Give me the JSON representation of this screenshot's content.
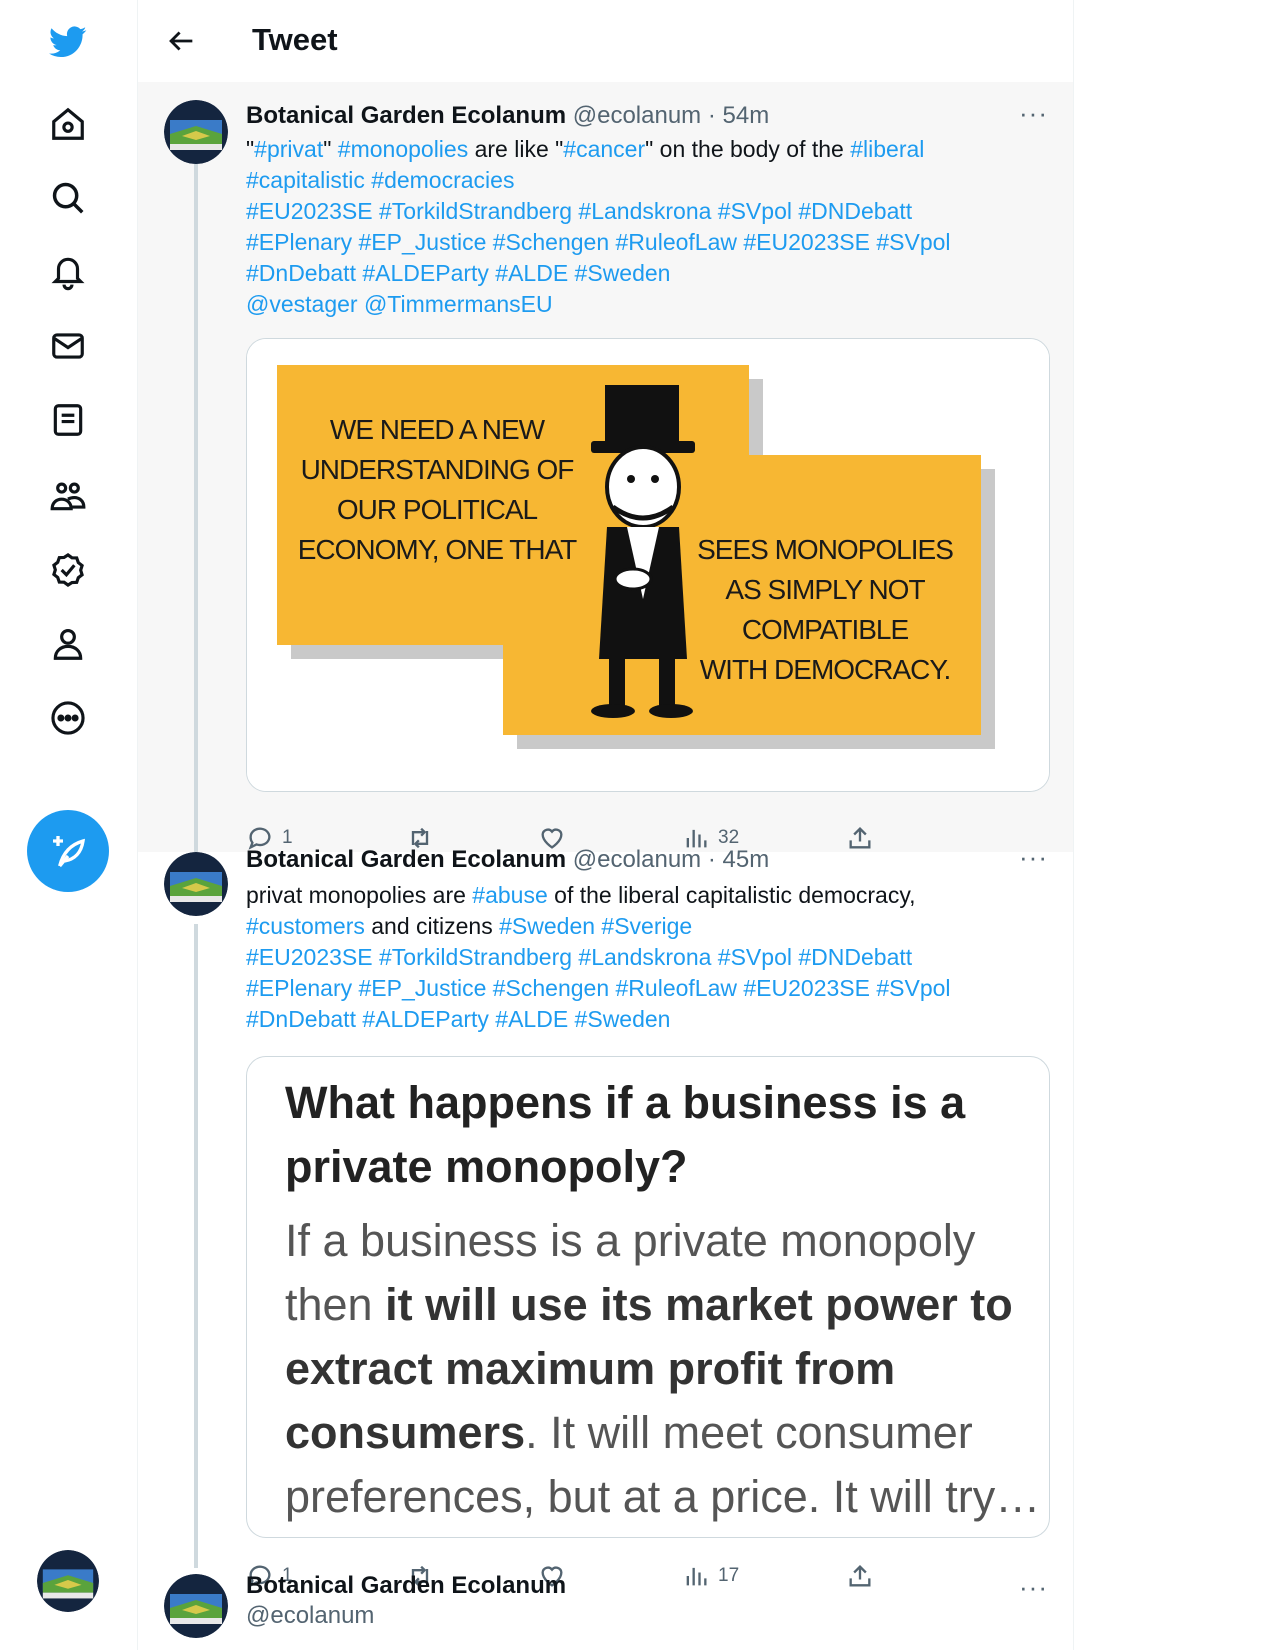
{
  "header": {
    "title": "Tweet"
  },
  "tweets": [
    {
      "name": "Botanical Garden Ecolanum",
      "handle": "@ecolanum",
      "time": "· 54m",
      "more": "···",
      "lines": [
        [
          {
            "t": "\"",
            "tag": false
          },
          {
            "t": "#privat",
            "tag": true
          },
          {
            "t": "\" ",
            "tag": false
          },
          {
            "t": "#monopolies",
            "tag": true
          },
          {
            "t": " are like \"",
            "tag": false
          },
          {
            "t": "#cancer",
            "tag": true
          },
          {
            "t": "\" on the body of the ",
            "tag": false
          },
          {
            "t": "#liberal",
            "tag": true
          }
        ],
        [
          {
            "t": "#capitalistic #democracies",
            "tag": true
          }
        ],
        [
          {
            "t": "#EU2023SE #TorkildStrandberg #Landskrona #SVpol #DNDebatt",
            "tag": true
          }
        ],
        [
          {
            "t": "#EPlenary #EP_Justice #Schengen #RuleofLaw #EU2023SE #SVpol",
            "tag": true
          }
        ],
        [
          {
            "t": "#DnDebatt #ALDEParty #ALDE #Sweden",
            "tag": true
          }
        ],
        [
          {
            "t": "@vestager @TimmermansEU",
            "tag": true
          }
        ]
      ],
      "poster": {
        "left_text": [
          "WE NEED A NEW",
          "UNDERSTANDING OF",
          "OUR POLITICAL",
          "ECONOMY, ONE THAT"
        ],
        "right_text": [
          "SEES MONOPOLIES",
          "AS SIMPLY NOT",
          "COMPATIBLE",
          "WITH DEMOCRACY."
        ]
      },
      "stats": {
        "replies": "1",
        "retweets": "",
        "likes": "",
        "views": "32"
      }
    },
    {
      "name": "Botanical Garden Ecolanum",
      "handle": "@ecolanum",
      "time": "· 45m",
      "more": "···",
      "lines": [
        [
          {
            "t": "privat monopolies are ",
            "tag": false
          },
          {
            "t": "#abuse",
            "tag": true
          },
          {
            "t": " of the liberal capitalistic democracy,",
            "tag": false
          }
        ],
        [
          {
            "t": "#customers",
            "tag": true
          },
          {
            "t": " and citizens ",
            "tag": false
          },
          {
            "t": "#Sweden #Sverige",
            "tag": true
          }
        ],
        [
          {
            "t": "#EU2023SE #TorkildStrandberg #Landskrona #SVpol #DNDebatt",
            "tag": true
          }
        ],
        [
          {
            "t": "#EPlenary #EP_Justice #Schengen #RuleofLaw #EU2023SE #SVpol",
            "tag": true
          }
        ],
        [
          {
            "t": "#DnDebatt #ALDEParty #ALDE #Sweden",
            "tag": true
          }
        ]
      ],
      "card": {
        "title_lines": [
          "What happens if a business is a",
          "private monopoly?"
        ],
        "text_lines": [
          [
            {
              "t": "If a business is a private monopoly",
              "b": false
            }
          ],
          [
            {
              "t": "then ",
              "b": false
            },
            {
              "t": "it will use its market power to",
              "b": true
            }
          ],
          [
            {
              "t": "extract maximum profit from",
              "b": true
            }
          ],
          [
            {
              "t": "consumers",
              "b": true
            },
            {
              "t": ". It will meet consumer",
              "b": false
            }
          ],
          [
            {
              "t": "preferences, but at a price. It will try…",
              "b": false
            }
          ]
        ]
      },
      "stats": {
        "replies": "1",
        "retweets": "",
        "likes": "",
        "views": "17"
      }
    },
    {
      "name": "Botanical Garden Ecolanum",
      "handle": "@ecolanum",
      "more": "···"
    }
  ]
}
